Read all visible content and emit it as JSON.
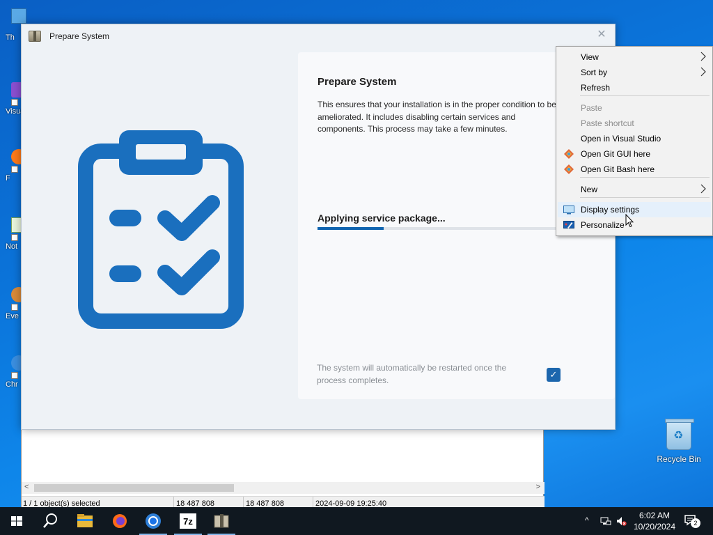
{
  "desktop": {
    "icons": [
      {
        "label": "Th",
        "color": "#5aa9e6"
      },
      {
        "label": "Visua",
        "color": "#8a4fd1"
      },
      {
        "label": "F",
        "color": "#ff7a1a"
      },
      {
        "label": "Not",
        "color": "#9bd46b"
      },
      {
        "label": "Eve",
        "color": "#d98a3a"
      },
      {
        "label": "Chr",
        "color": "#3b8fe0"
      }
    ],
    "recycle_bin": {
      "label": "Recycle Bin"
    }
  },
  "bg_window": {
    "status": {
      "selection": "1 / 1 object(s) selected",
      "size": "18 487 808",
      "packed_size": "18 487 808",
      "modified": "2024-09-09 19:25:40"
    }
  },
  "dialog": {
    "title": "Prepare System",
    "close_glyph": "✕",
    "panel": {
      "heading": "Prepare System",
      "description": "This ensures that your installation is in the proper condition to be ameliorated. It includes disabling certain services and components. This process may take a few minutes.",
      "status": "Applying service package...",
      "progress_fraction": 0.275,
      "restart_note": "The system will automatically be restarted once the process completes.",
      "restart_checked": true,
      "check_glyph": "✓"
    },
    "colors": {
      "accent": "#1064b0",
      "art": "#1a6fbe"
    }
  },
  "context_menu": {
    "items": [
      {
        "label": "View",
        "submenu": true,
        "disabled": false,
        "icon": ""
      },
      {
        "label": "Sort by",
        "submenu": true,
        "disabled": false,
        "icon": ""
      },
      {
        "label": "Refresh",
        "submenu": false,
        "disabled": false,
        "icon": ""
      },
      {
        "label": "Paste",
        "submenu": false,
        "disabled": true,
        "icon": ""
      },
      {
        "label": "Paste shortcut",
        "submenu": false,
        "disabled": true,
        "icon": ""
      },
      {
        "label": "Open in Visual Studio",
        "submenu": false,
        "disabled": false,
        "icon": ""
      },
      {
        "label": "Open Git GUI here",
        "submenu": false,
        "disabled": false,
        "icon": "git-icon"
      },
      {
        "label": "Open Git Bash here",
        "submenu": false,
        "disabled": false,
        "icon": "git-icon"
      },
      {
        "label": "New",
        "submenu": true,
        "disabled": false,
        "icon": ""
      },
      {
        "label": "Display settings",
        "submenu": false,
        "disabled": false,
        "icon": "display-icon",
        "highlighted": true
      },
      {
        "label": "Personalize",
        "submenu": false,
        "disabled": false,
        "icon": "personalize-icon"
      }
    ]
  },
  "taskbar": {
    "apps": [
      "start-icon",
      "search-icon",
      "file-explorer-icon",
      "firefox-icon",
      "chrome-icon",
      "7zip-icon",
      "installer-icon"
    ],
    "sevenzip_label": "7z",
    "tray_chevron": "^",
    "time": "6:02 AM",
    "date": "10/20/2024",
    "notification_count": "2"
  }
}
